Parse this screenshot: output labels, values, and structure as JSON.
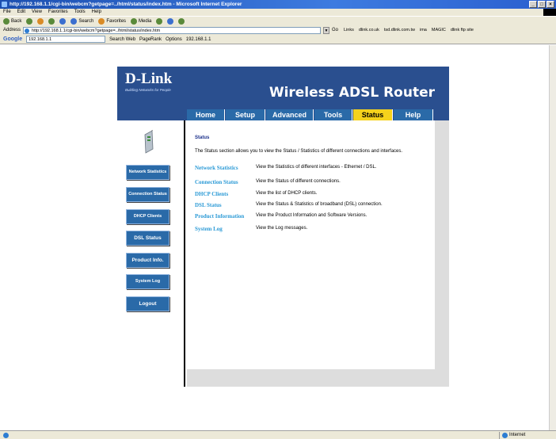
{
  "window": {
    "title": "http://192.168.1.1/cgi-bin/webcm?getpage=../html/status/index.htm - Microsoft Internet Explorer"
  },
  "menu": [
    "File",
    "Edit",
    "View",
    "Favorites",
    "Tools",
    "Help"
  ],
  "toolbar": {
    "back": "Back",
    "search": "Search",
    "favorites": "Favorites",
    "media": "Media"
  },
  "addressbar": {
    "label": "Address",
    "url": "http://192.168.1.1/cgi-bin/webcm?getpage=../html/status/index.htm",
    "go": "Go",
    "links_label": "Links",
    "links": [
      "dlink.co.uk",
      "tsd.dlink.com.tw",
      "ima",
      "MAGIC",
      "dlink ftp site"
    ]
  },
  "googlebar": {
    "logo": "Google",
    "query": "192.168.1.1",
    "search_web": "Search Web",
    "pagerank": "PageRank",
    "options": "Options",
    "highlight": "192.168.1.1"
  },
  "statusbar": {
    "zone": "Internet"
  },
  "router": {
    "logo": "D-Link",
    "tagline": "Building Networks for People",
    "product": "Wireless ADSL Router",
    "tabs": [
      {
        "label": "Home",
        "active": false
      },
      {
        "label": "Setup",
        "active": false
      },
      {
        "label": "Advanced",
        "active": false
      },
      {
        "label": "Tools",
        "active": false
      },
      {
        "label": "Status",
        "active": true
      },
      {
        "label": "Help",
        "active": false
      }
    ],
    "side_buttons": [
      "Network Statistics",
      "Connection Status",
      "DHCP Clients",
      "DSL Status",
      "Product Info.",
      "System Log",
      "Logout"
    ],
    "section_title": "Status",
    "section_desc": "The Status section allows you to view the Status / Statistics of different connections and interfaces.",
    "links": [
      {
        "label": "Network Statistics",
        "desc": "View the Statistics of different interfaces - Ethernet / DSL."
      },
      {
        "label": "Connection Status",
        "desc": "View the Status of different connections."
      },
      {
        "label": "DHCP Clients",
        "desc": "View the list of DHCP clients."
      },
      {
        "label": "DSL Status",
        "desc": "View the Status & Statistics of broadband (DSL) connection."
      },
      {
        "label": "Product Information",
        "desc": "View the Product Information and Software Versions."
      },
      {
        "label": "System Log",
        "desc": "View the Log messages."
      }
    ],
    "colors": {
      "header_blue": "#2a4f8f",
      "tab_blue": "#2a6aa8",
      "tab_active": "#f5d21c",
      "link": "#2b9ad6"
    }
  }
}
